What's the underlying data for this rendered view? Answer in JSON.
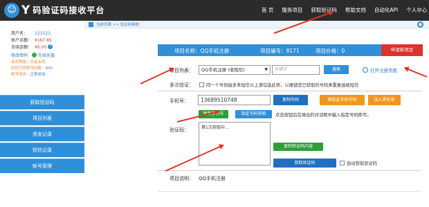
{
  "app": {
    "logo_mark": "☺",
    "logo_letter": "Y",
    "logo_text": "码验证码接收平台"
  },
  "nav": [
    "首 页",
    "服务项目",
    "获取验证码",
    "帮助文档",
    "自动化API",
    "个人中心"
  ],
  "user": {
    "name_label": "用户名：",
    "name_value": "123123",
    "balance_label": "账户余额：",
    "balance_value": "¥167.85",
    "frozen_label": "冻结金额：",
    "frozen_value": "¥0.00",
    "help_mark": "?",
    "edit_password": "修改密码",
    "online_recharge": "在线充值",
    "level": "会员等级：白金会员",
    "concurrent_label": "同时可获取号码数：",
    "concurrent_value": "500",
    "account_status_label": "账号状态：",
    "account_status_value": "正常状态"
  },
  "menu": [
    "获取验证码",
    "项目列表",
    "资金记录",
    "短信记录",
    "帐号管理"
  ],
  "breadcrumb": "当前页面 >> 验证码接收",
  "project": {
    "name": "项目名称：QQ手机注册",
    "id": "项目编号：8171",
    "price": "项目价格：0",
    "apply_button": "申请新项目"
  },
  "form": {
    "project_list_label": "项目列表：",
    "project_selected": "QQ手机注册 (收短信)",
    "keyword_placeholder": "关键字",
    "search_button": "搜索",
    "open_register": "打开注册页面",
    "multi_verify_label": "多次验证：",
    "multi_verify_text": "同一个号码接多条短信以上请勾选此项，以便锁定已获取的号码来重复接收短信",
    "phone_label": "手机号：",
    "phone_value": "13689510748",
    "copy_number_btn": "复制号码",
    "release_btn": "释放此手机号码",
    "blacklist_btn": "加入黑名单",
    "copy_phone_btn": "复制手机号",
    "assign_btn": "指定号码获取",
    "assign_hint": "点击按钮后在弹出的对话框中输入指定号码即可。",
    "code_label": "验证码：",
    "code_value": "第1次获取中...",
    "copy_code_btn": "复制验证码内容",
    "get_code_btn": "获取验证码",
    "auto_get_text": "自动获取验证码",
    "desc_label": "项目说明：",
    "desc_value": "QQ手机注册"
  }
}
